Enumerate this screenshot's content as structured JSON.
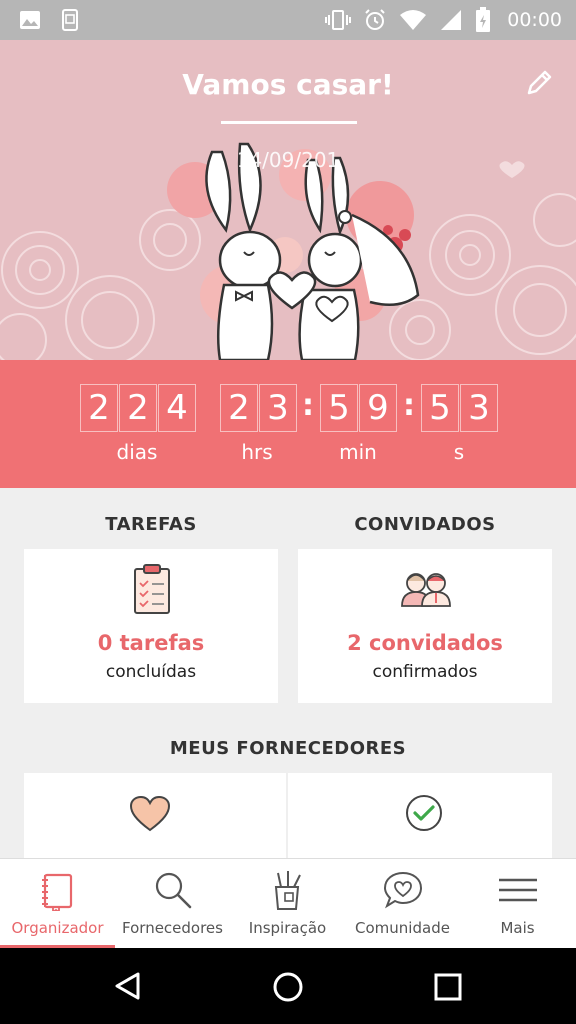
{
  "status_bar": {
    "time": "00:00",
    "icons": [
      "image-icon",
      "screenshot-icon",
      "vibrate-icon",
      "alarm-icon",
      "wifi-icon",
      "signal-icon",
      "battery-icon"
    ]
  },
  "hero": {
    "title": "Vamos casar!",
    "date": "14/09/201",
    "edit_icon": "pencil-icon"
  },
  "countdown": {
    "days": [
      "2",
      "2",
      "4"
    ],
    "hours": [
      "2",
      "3"
    ],
    "minutes": [
      "5",
      "9"
    ],
    "seconds": [
      "5",
      "3"
    ],
    "labels": {
      "days": "dias",
      "hours": "hrs",
      "minutes": "min",
      "seconds": "s"
    },
    "color": "#f07174"
  },
  "tasks": {
    "section_title": "TAREFAS",
    "count_text": "0 tarefas",
    "sub_text": "concluídas",
    "icon": "clipboard-icon"
  },
  "guests": {
    "section_title": "CONVIDADOS",
    "count_text": "2 convidados",
    "sub_text": "confirmados",
    "icon": "couple-icon"
  },
  "vendors": {
    "section_title": "MEUS FORNECEDORES",
    "icons": [
      "heart-icon",
      "check-circle-icon"
    ]
  },
  "bottom_nav": {
    "items": [
      {
        "label": "Organizador",
        "icon": "notebook-icon",
        "active": true
      },
      {
        "label": "Fornecedores",
        "icon": "search-icon",
        "active": false
      },
      {
        "label": "Inspiração",
        "icon": "brush-cup-icon",
        "active": false
      },
      {
        "label": "Comunidade",
        "icon": "chat-heart-icon",
        "active": false
      },
      {
        "label": "Mais",
        "icon": "menu-icon",
        "active": false
      }
    ],
    "accent": "#e8676b"
  },
  "system_nav": {
    "icons": [
      "back-icon",
      "home-icon",
      "recents-icon"
    ]
  }
}
